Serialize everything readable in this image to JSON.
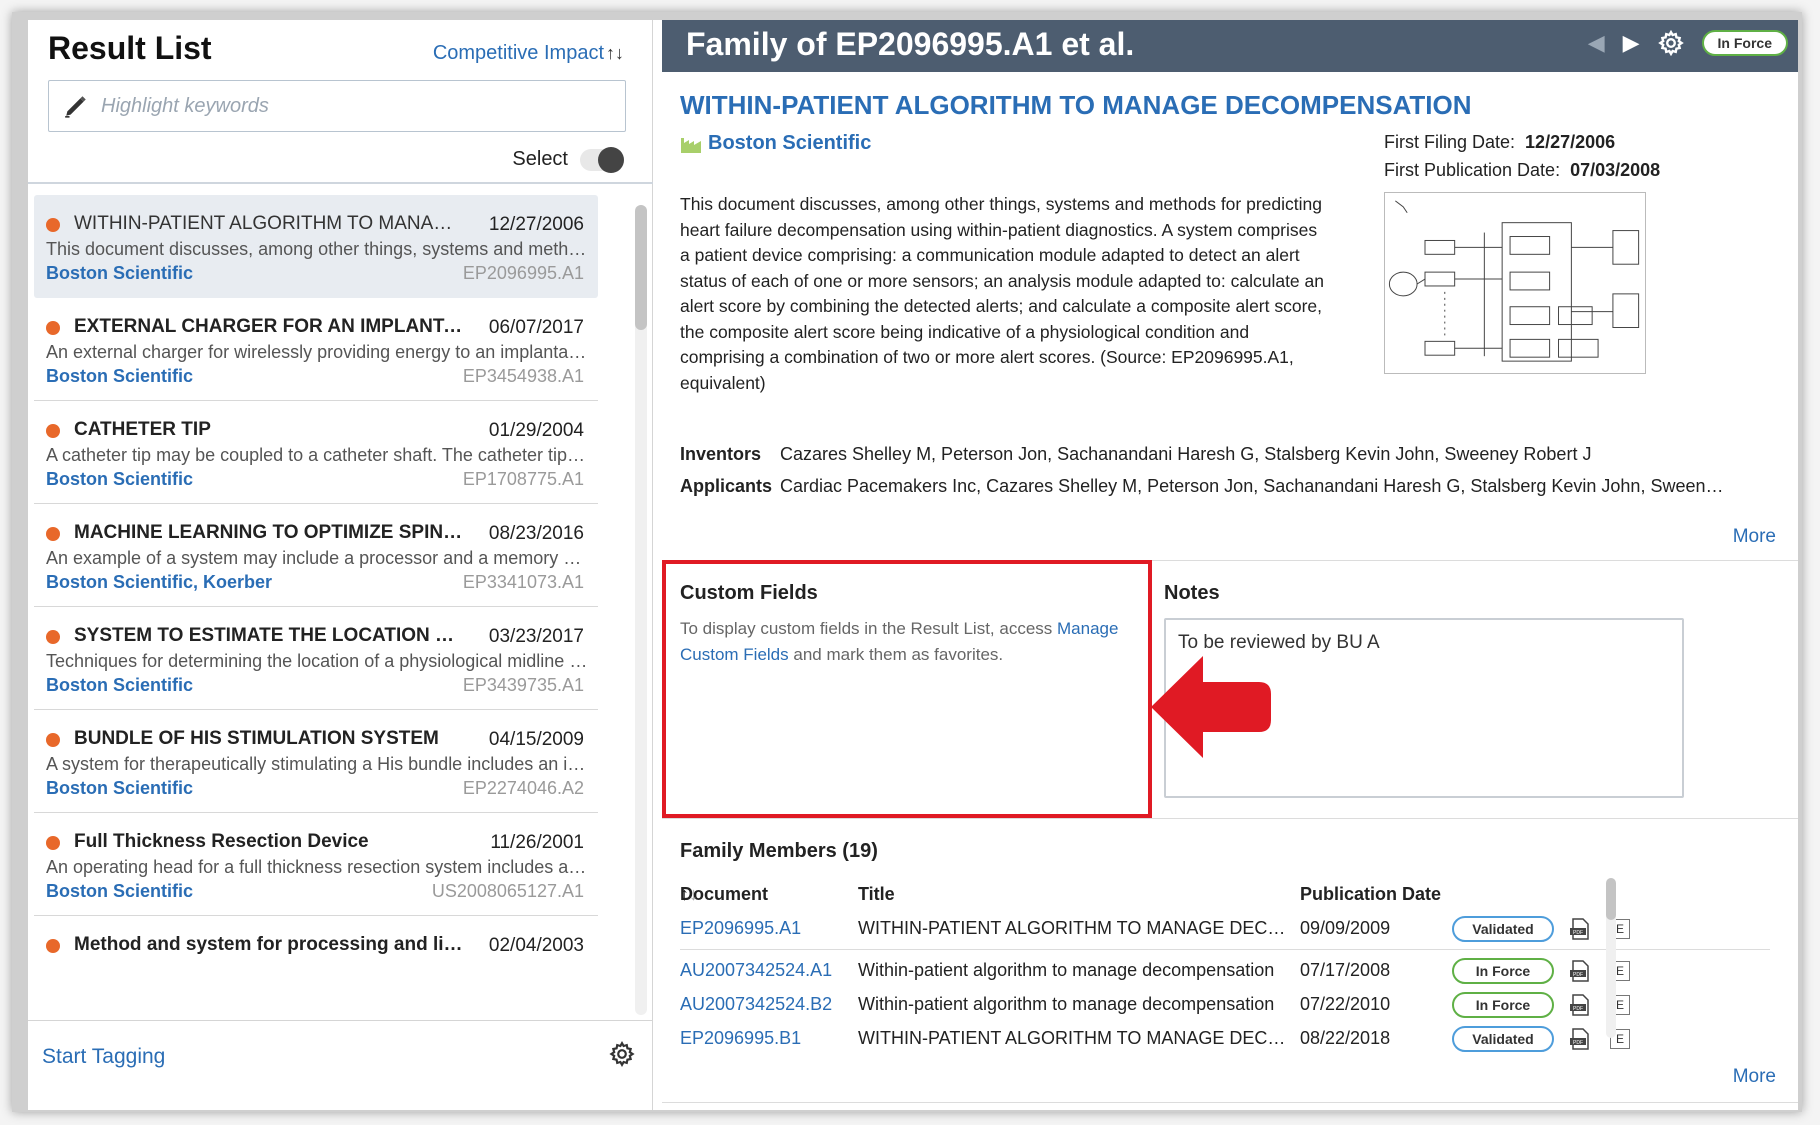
{
  "result_list": {
    "title": "Result List",
    "sort_label": "Competitive Impact",
    "sort_icon": "sort-arrows-icon",
    "highlight_placeholder": "Highlight keywords",
    "select_label": "Select",
    "select_toggle_on": false,
    "items": [
      {
        "title": "WITHIN-PATIENT ALGORITHM TO MANAGE D...",
        "date": "12/27/2006",
        "description": "This document discusses, among other things, systems and methods...",
        "company": "Boston Scientific",
        "number": "EP2096995.A1",
        "selected": true
      },
      {
        "title": "EXTERNAL CHARGER FOR AN IMPLANTABLE ...",
        "date": "06/07/2017",
        "description": "An external charger for wirelessly providing energy to an implantabl...",
        "company": "Boston Scientific",
        "number": "EP3454938.A1",
        "selected": false
      },
      {
        "title": "CATHETER TIP",
        "date": "01/29/2004",
        "description": "A catheter tip may be coupled to a catheter shaft. The catheter tip m...",
        "company": "Boston Scientific",
        "number": "EP1708775.A1",
        "selected": false
      },
      {
        "title": "MACHINE LEARNING TO OPTIMIZE SPINAL CO...",
        "date": "08/23/2016",
        "description": "An example of a system may include a processor and a memory devi...",
        "company": "Boston Scientific, Koerber",
        "number": "EP3341073.A1",
        "selected": false
      },
      {
        "title": "SYSTEM TO ESTIMATE THE LOCATION OF A SP...",
        "date": "03/23/2017",
        "description": "Techniques for determining the location of a physiological midline ar...",
        "company": "Boston Scientific",
        "number": "EP3439735.A1",
        "selected": false
      },
      {
        "title": "BUNDLE OF HIS STIMULATION SYSTEM",
        "date": "04/15/2009",
        "description": "A system for therapeutically stimulating a His bundle includes an im...",
        "company": "Boston Scientific",
        "number": "EP2274046.A2",
        "selected": false
      },
      {
        "title": "Full Thickness Resection Device",
        "date": "11/26/2001",
        "description": "An operating head for a full thickness resection system includes a fir...",
        "company": "Boston Scientific",
        "number": "US2008065127.A1",
        "selected": false
      },
      {
        "title": "Method and system for processing and linking da...",
        "date": "02/04/2003",
        "description": "",
        "company": "",
        "number": "",
        "selected": false
      }
    ],
    "start_tagging_label": "Start Tagging"
  },
  "detail": {
    "header_title": "Family of EP2096995.A1 et al.",
    "status_badge": "In Force",
    "doc_title": "WITHIN-PATIENT ALGORITHM TO MANAGE DECOMPENSATION",
    "assignee": "Boston Scientific",
    "first_filing_label": "First Filing Date:",
    "first_filing_date": "12/27/2006",
    "first_pub_label": "First Publication Date:",
    "first_pub_date": "07/03/2008",
    "abstract": "This document discusses, among other things, systems and methods for predicting heart failure decompensation using within-patient diagnostics. A system comprises a patient device comprising: a communication module adapted to detect an alert status of each of one or more sensors; an analysis module adapted to: calculate an alert score by combining the detected alerts; and calculate a composite alert score, the composite alert score being indicative of a physiological condition and comprising a combination of two or more alert scores. (Source: EP2096995.A1, equivalent)",
    "inventors_label": "Inventors",
    "inventors": "Cazares Shelley M, Peterson Jon, Sachanandani Haresh G, Stalsberg Kevin John, Sweeney Robert J",
    "applicants_label": "Applicants",
    "applicants": "Cardiac Pacemakers Inc, Cazares Shelley M, Peterson Jon, Sachanandani Haresh G, Stalsberg Kevin John, Sweeney Rob...",
    "more_label": "More",
    "custom_fields_title": "Custom Fields",
    "custom_fields_text_1": "To display custom fields in the Result List, access ",
    "custom_fields_link": "Manage Custom Fields",
    "custom_fields_text_2": " and mark them as favorites.",
    "notes_title": "Notes",
    "notes_value": "To be reviewed by BU A",
    "family_title": "Family Members (19)",
    "family_cols": {
      "document": "Document",
      "title": "Title",
      "pub_date": "Publication Date"
    },
    "family_rows": [
      {
        "document": "EP2096995.A1",
        "title": "WITHIN-PATIENT ALGORITHM TO MANAGE DECOMPENS...",
        "pub_date": "09/09/2009",
        "status": "Validated"
      },
      {
        "document": "AU2007342524.A1",
        "title": "Within-patient algorithm to manage decompensation",
        "pub_date": "07/17/2008",
        "status": "In Force"
      },
      {
        "document": "AU2007342524.B2",
        "title": "Within-patient algorithm to manage decompensation",
        "pub_date": "07/22/2010",
        "status": "In Force"
      },
      {
        "document": "EP2096995.B1",
        "title": "WITHIN-PATIENT ALGORITHM TO MANAGE DECOMPENS...",
        "pub_date": "08/22/2018",
        "status": "Validated"
      }
    ],
    "family_more_label": "More",
    "e_label": "E"
  },
  "colors": {
    "header_bg": "#4d5d70",
    "link_blue": "#2a6db5",
    "dot_orange": "#e8682a",
    "highlight_red": "#e01a24",
    "in_force_green": "#5fb045",
    "validated_blue": "#4e9ddb"
  }
}
